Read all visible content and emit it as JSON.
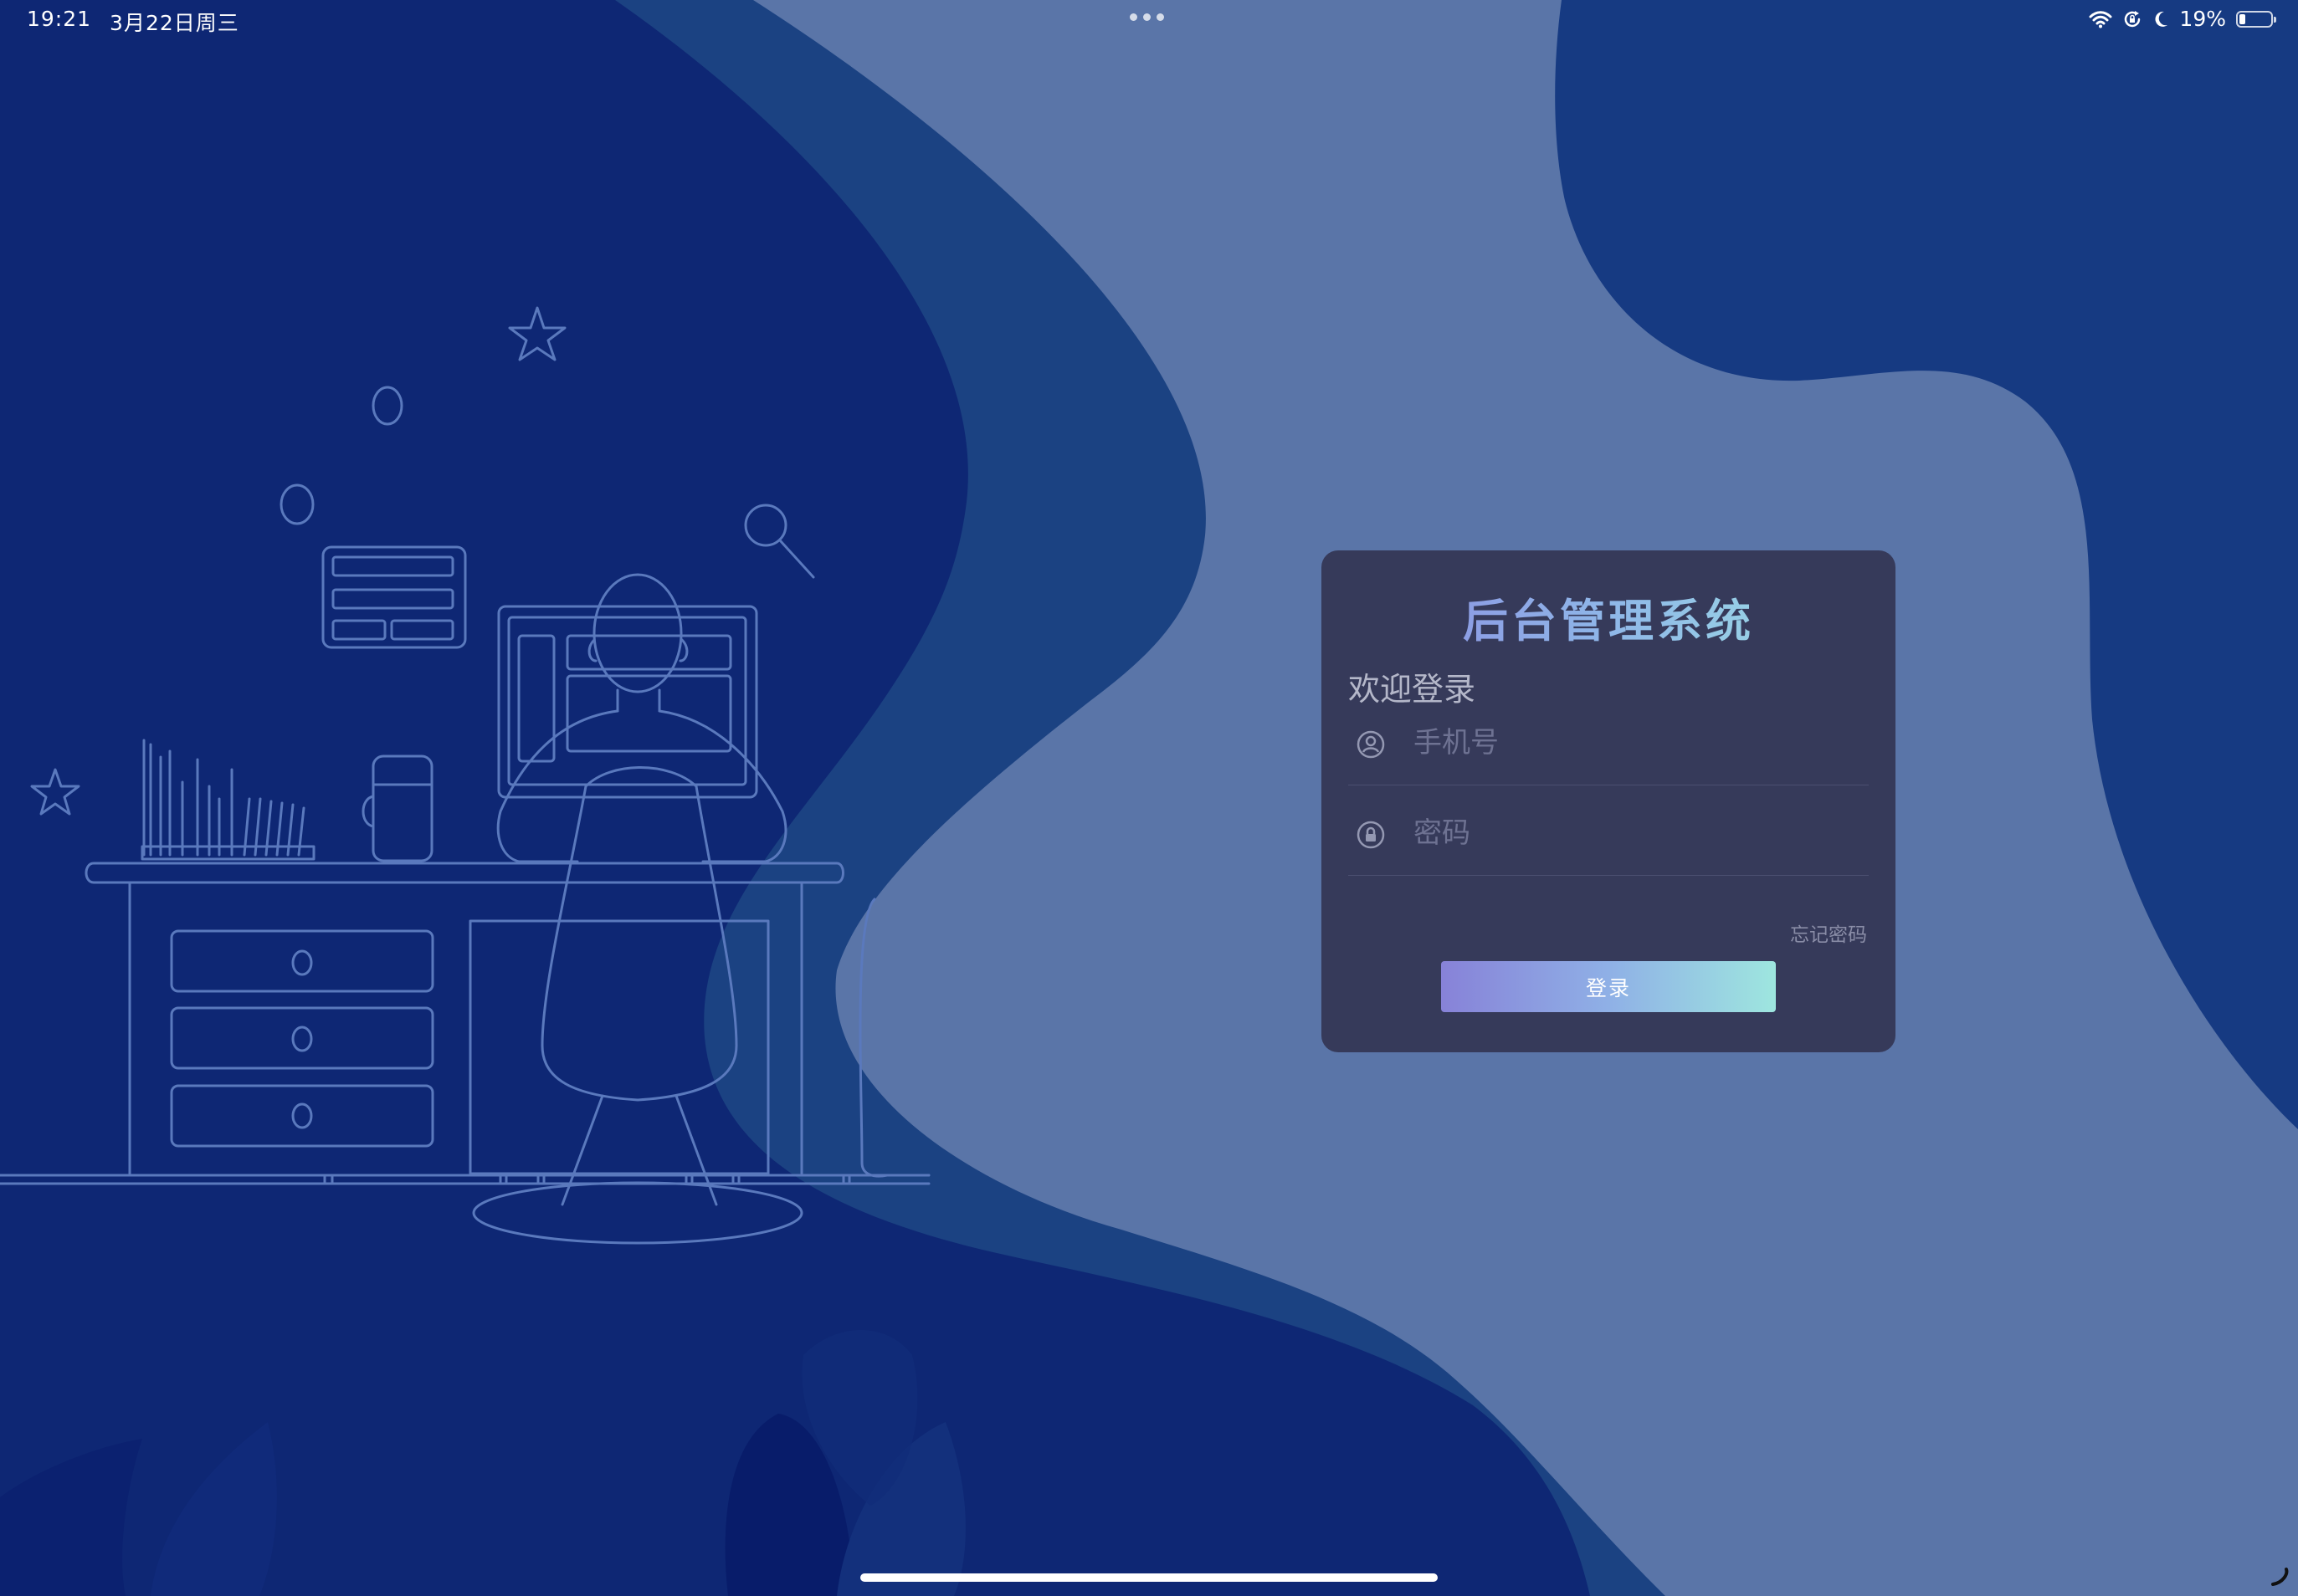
{
  "status_bar": {
    "time": "19:21",
    "date": "3月22日周三",
    "battery_percent_label": "19%",
    "battery_level": 0.19
  },
  "login": {
    "title": "后台管理系统",
    "welcome": "欢迎登录",
    "phone_placeholder": "手机号",
    "password_placeholder": "密码",
    "forgot_password": "忘记密码",
    "submit": "登录"
  },
  "colors": {
    "background_light": "#5a75a8",
    "background_dark": "#0e2774",
    "card": "#363a5a",
    "gradient_start": "#8782d8",
    "gradient_end": "#9ee6df"
  },
  "icons": {
    "phone_field": "user-circle-icon",
    "password_field": "lock-circle-icon",
    "wifi": "wifi-icon",
    "orientation_lock": "rotation-lock-icon",
    "do_not_disturb": "moon-icon",
    "battery": "battery-icon"
  }
}
